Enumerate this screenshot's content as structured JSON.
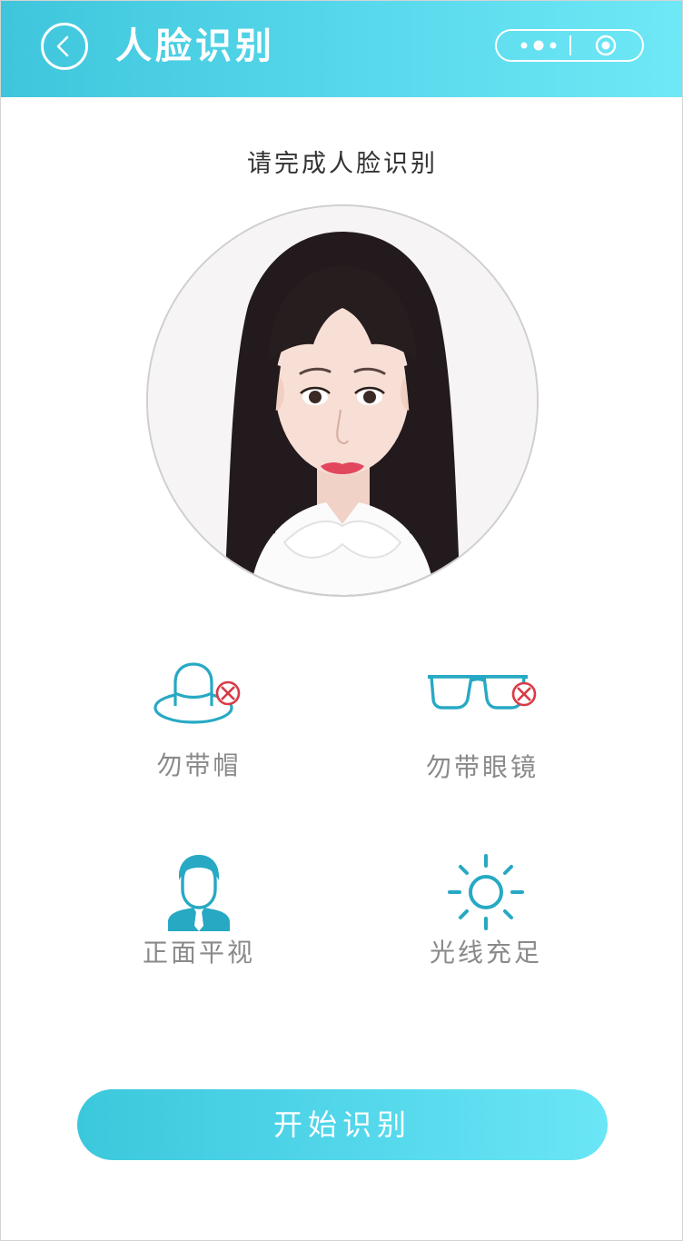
{
  "header": {
    "title": "人脸识别",
    "back_icon": "chevron-left-icon",
    "more_icon": "more-dots-icon",
    "close_icon": "target-close-icon"
  },
  "prompt": "请完成人脸识别",
  "photo": {
    "description_icon": "face-photo"
  },
  "tips": [
    {
      "label": "勿带帽",
      "icon": "hat-icon"
    },
    {
      "label": "勿带眼镜",
      "icon": "glasses-icon"
    },
    {
      "label": "正面平视",
      "icon": "person-front-icon"
    },
    {
      "label": "光线充足",
      "icon": "sun-icon"
    }
  ],
  "start_button": {
    "label": "开始识别"
  },
  "colors": {
    "accent": "#4ccfe4",
    "icon": "#27a9c4",
    "forbid": "#d93a45",
    "tip_text": "#8a8a8a"
  }
}
